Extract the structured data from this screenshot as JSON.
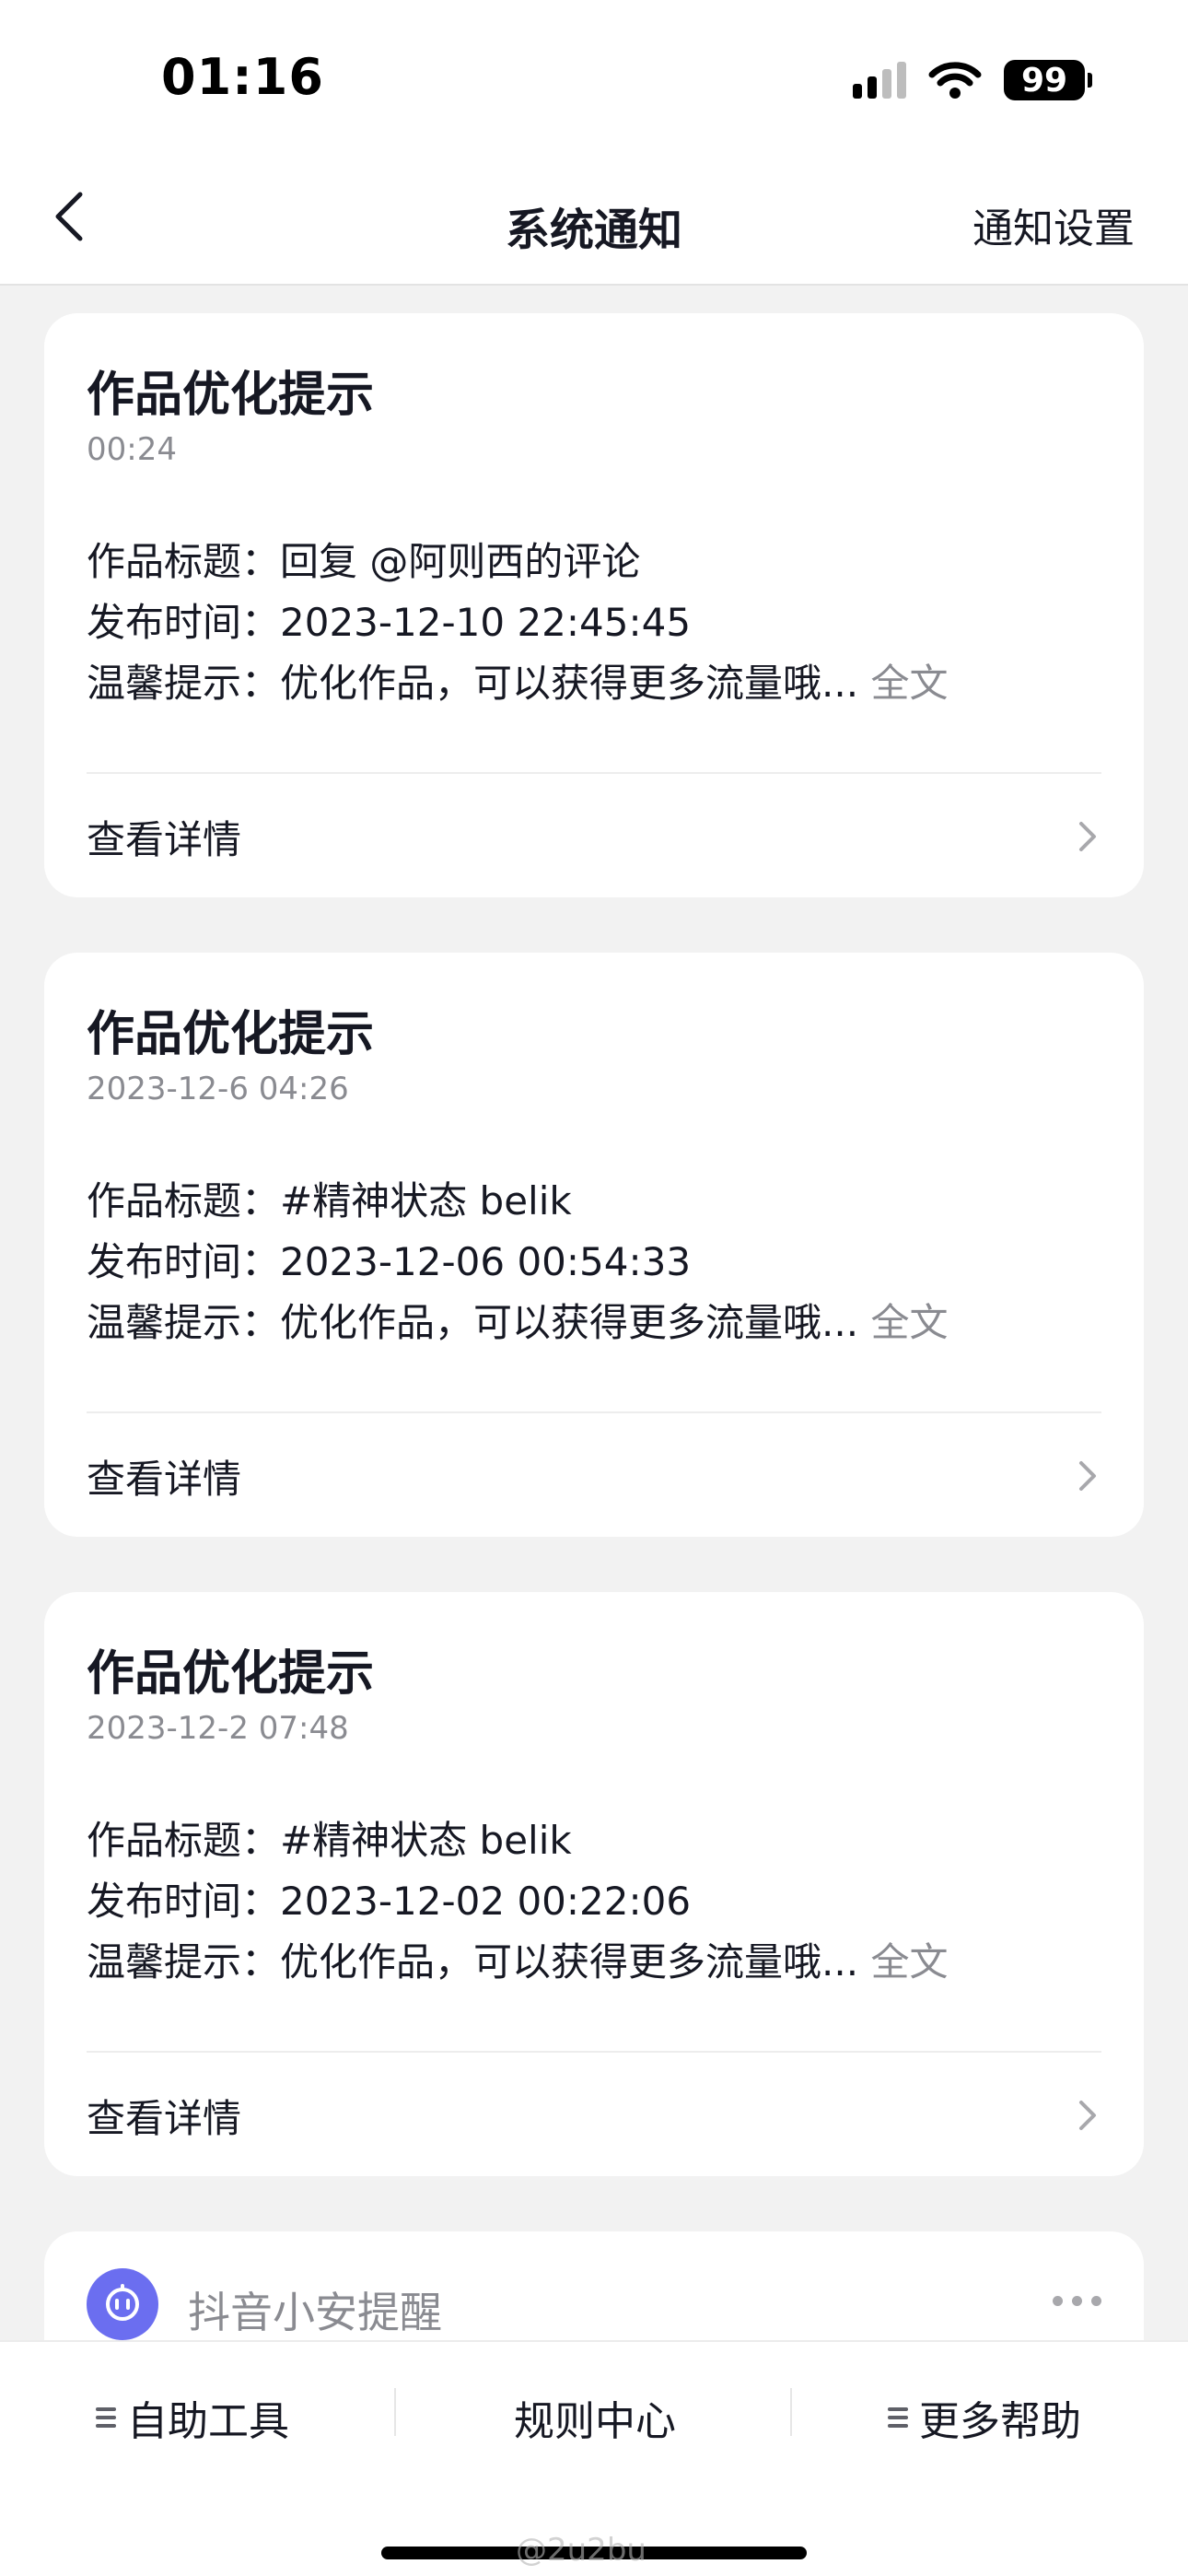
{
  "status": {
    "time": "01:16",
    "battery": "99"
  },
  "nav": {
    "title": "系统通知",
    "settings": "通知设置"
  },
  "cards": [
    {
      "title": "作品优化提示",
      "time": "00:24",
      "work_label": "作品标题：",
      "work_value": "回复 @阿则西的评论",
      "publish_label": "发布时间：",
      "publish_value": "2023-12-10 22:45:45",
      "tip_label": "温馨提示：",
      "tip_value": "优化作品，可以获得更多流量哦...",
      "full_text": "全文",
      "footer": "查看详情"
    },
    {
      "title": "作品优化提示",
      "time": "2023-12-6 04:26",
      "work_label": "作品标题：",
      "work_value": "#精神状态 belik",
      "publish_label": "发布时间：",
      "publish_value": "2023-12-06 00:54:33",
      "tip_label": "温馨提示：",
      "tip_value": "优化作品，可以获得更多流量哦...",
      "full_text": "全文",
      "footer": "查看详情"
    },
    {
      "title": "作品优化提示",
      "time": "2023-12-2 07:48",
      "work_label": "作品标题：",
      "work_value": "#精神状态 belik",
      "publish_label": "发布时间：",
      "publish_value": "2023-12-02 00:22:06",
      "tip_label": "温馨提示：",
      "tip_value": "优化作品，可以获得更多流量哦...",
      "full_text": "全文",
      "footer": "查看详情"
    }
  ],
  "assistant": {
    "name": "抖音小安提醒"
  },
  "bottom_tabs": [
    "自助工具",
    "规则中心",
    "更多帮助"
  ],
  "watermark": "@2u2bu"
}
